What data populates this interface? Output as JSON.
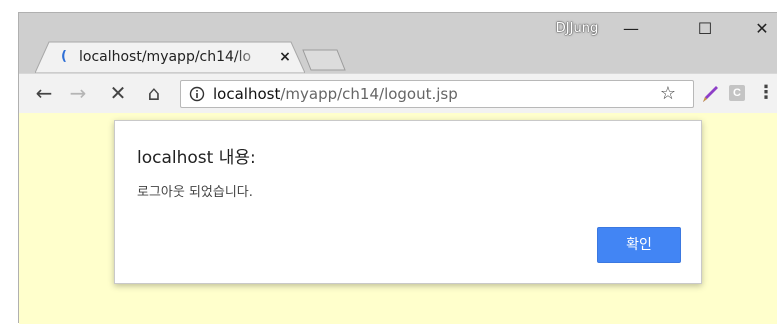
{
  "tab": {
    "favicon": "loading-spinner-icon",
    "title": "localhost/myapp/ch14/lo",
    "close_label": "×"
  },
  "window": {
    "profile_name": "DJJung",
    "minimize_label": "—",
    "maximize_label": "☐",
    "close_label": "✕"
  },
  "toolbar": {
    "back_icon": "←",
    "forward_icon": "→",
    "reload_icon": "✕",
    "home_icon": "⌂",
    "url_host": "localhost",
    "url_path": "/myapp/ch14/logout.jsp",
    "star_icon": "☆",
    "ext_c_label": "C",
    "menu_icon": "⋮"
  },
  "page": {
    "background": "#ffffcc"
  },
  "dialog": {
    "title": "localhost 내용:",
    "message": "로그아웃 되었습니다.",
    "ok_label": "확인",
    "ok_color": "#4285f4"
  }
}
